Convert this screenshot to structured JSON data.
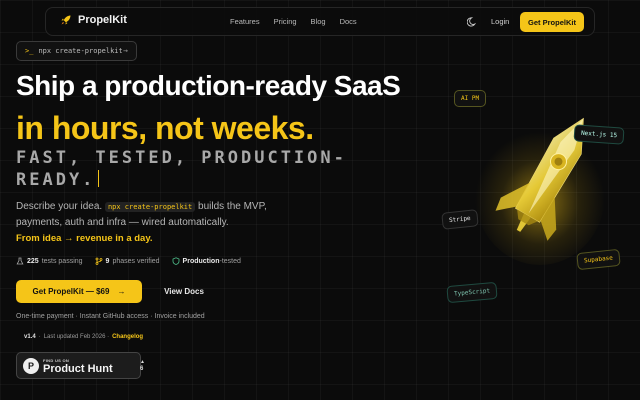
{
  "nav": {
    "brand": "PropelKit",
    "links": [
      "Features",
      "Pricing",
      "Blog",
      "Docs"
    ],
    "login": "Login",
    "cta": "Get PropelKit"
  },
  "command_chip": {
    "prompt": ">_",
    "command": "npx create-propelkit",
    "arrow": "→"
  },
  "hero": {
    "headline_1": "Ship a production-ready SaaS",
    "headline_2": "in hours, not weeks.",
    "tagline": "FAST, TESTED, PRODUCTION-READY.",
    "desc_before": "Describe your idea.",
    "desc_code": "npx create-propelkit",
    "desc_after": "builds the MVP, payments, auth and infra — wired automatically.",
    "from_idea": "From idea → revenue in a day."
  },
  "stats": [
    {
      "icon": "flask-icon",
      "value": "225",
      "label": "tests passing"
    },
    {
      "icon": "git-branch-icon",
      "value": "9",
      "label": "phases verified"
    },
    {
      "icon": "shield-icon",
      "value": "Production",
      "label": "-tested"
    }
  ],
  "buttons": {
    "primary": "Get PropelKit — $69",
    "primary_arrow": "→",
    "secondary": "View Docs"
  },
  "note": "One-time payment · Instant GitHub access · Invoice included",
  "updated": {
    "version": "v1.4",
    "sep": "·",
    "text": "Last updated Feb 2026 ·",
    "changelog": "Changelog"
  },
  "product_hunt": {
    "small": "FIND US ON",
    "name": "Product Hunt",
    "logo": "P",
    "triangle": "▲",
    "count": "6"
  },
  "tags": {
    "ai": "AI PM",
    "next": "Next.js 15",
    "stripe": "Stripe",
    "supabase": "Supabase",
    "ts": "TypeScript"
  },
  "colors": {
    "accent": "#f5c518",
    "background": "#0b0b0b"
  }
}
